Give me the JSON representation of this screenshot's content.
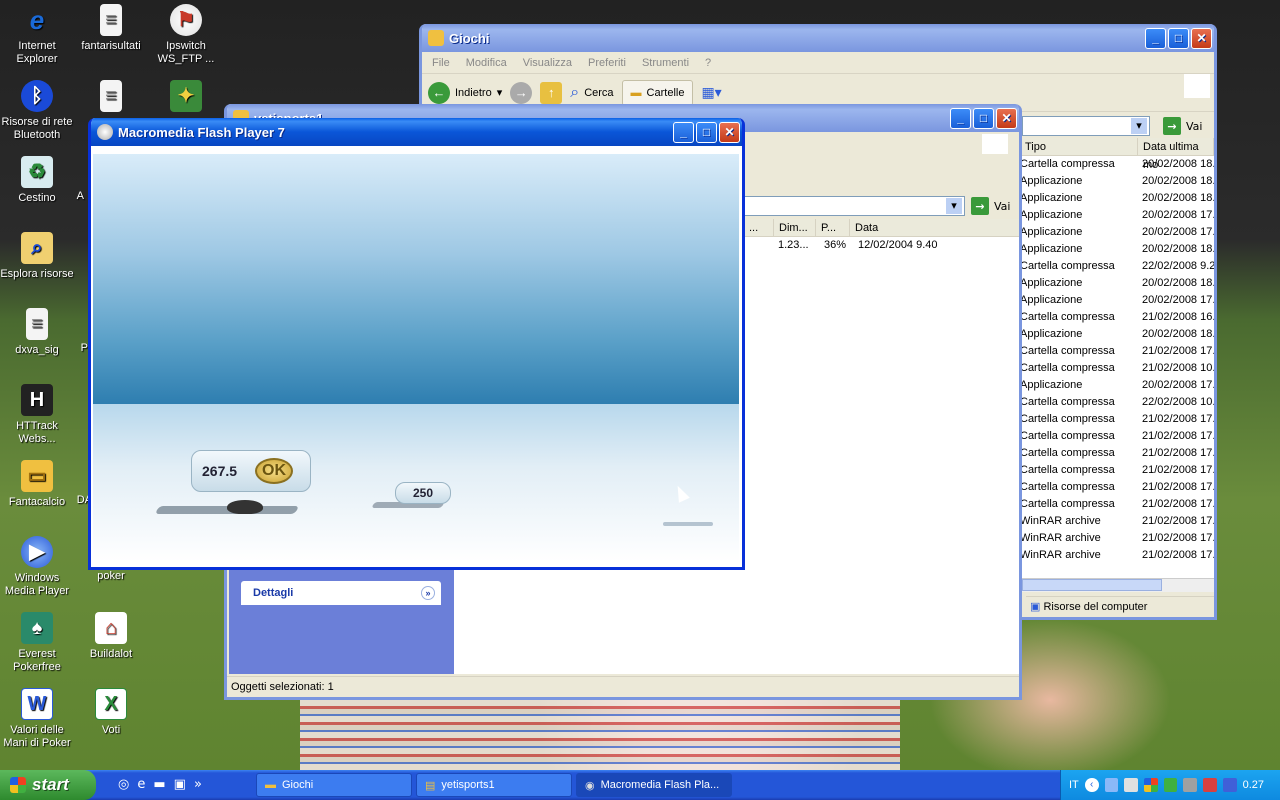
{
  "desktop": {
    "icons": [
      {
        "label": "Internet Explorer",
        "glyph": "e",
        "color": "#1a6ad8"
      },
      {
        "label": "fantarisultati",
        "glyph": "≡",
        "color": "#f4f4f4"
      },
      {
        "label": "Ipswitch WS_FTP ...",
        "glyph": "⚑",
        "color": "#c83a2a"
      },
      {
        "label": "Risorse di rete Bluetooth",
        "glyph": "ᛒ",
        "color": "#1a4ad8"
      },
      {
        "label": "Cestino",
        "glyph": "♻",
        "color": "#a8d0a8"
      },
      {
        "label": "Esplora risorse",
        "glyph": "🔍",
        "color": "#f0d070"
      },
      {
        "label": "dxva_sig",
        "glyph": "≡",
        "color": "#f4f4f4"
      },
      {
        "label": "HTTrack Webs...",
        "glyph": "H",
        "color": "#222"
      },
      {
        "label": "Fantacalcio",
        "glyph": "▭",
        "color": "#f0c040"
      },
      {
        "label": "Windows Media Player",
        "glyph": "▶",
        "color": "#4a8ae8"
      },
      {
        "label": "poker",
        "glyph": "",
        "color": "transparent"
      },
      {
        "label": "Everest Pokerfree",
        "glyph": "♠",
        "color": "#2a8a6a"
      },
      {
        "label": "Buildalot",
        "glyph": "⌂",
        "color": "#e8c040"
      },
      {
        "label": "Valori delle Mani di Poker",
        "glyph": "W",
        "color": "#2a5ad8"
      },
      {
        "label": "Voti",
        "glyph": "X",
        "color": "#2a8a3a"
      },
      {
        "label_a": "A",
        "label_p": "P",
        "label_da": "DA"
      }
    ]
  },
  "giochi_window": {
    "title": "Giochi",
    "menu": [
      "File",
      "Modifica",
      "Visualizza",
      "Preferiti",
      "Strumenti",
      "?"
    ],
    "toolbar": {
      "back": "Indietro",
      "search": "Cerca",
      "folders": "Cartelle",
      "go": "Vai"
    },
    "columns": [
      "Tipo",
      "Data ultima mo"
    ],
    "rows": [
      [
        "Cartella compressa",
        "20/02/2008 18."
      ],
      [
        "Applicazione",
        "20/02/2008 18."
      ],
      [
        "Applicazione",
        "20/02/2008 18."
      ],
      [
        "Applicazione",
        "20/02/2008 17."
      ],
      [
        "Applicazione",
        "20/02/2008 17."
      ],
      [
        "Applicazione",
        "20/02/2008 18."
      ],
      [
        "Cartella compressa",
        "22/02/2008 9.2"
      ],
      [
        "Applicazione",
        "20/02/2008 18."
      ],
      [
        "Applicazione",
        "20/02/2008 17."
      ],
      [
        "Cartella compressa",
        "21/02/2008 16."
      ],
      [
        "Applicazione",
        "20/02/2008 18."
      ],
      [
        "Cartella compressa",
        "21/02/2008 17."
      ],
      [
        "Cartella compressa",
        "21/02/2008 10."
      ],
      [
        "Applicazione",
        "20/02/2008 17."
      ],
      [
        "Cartella compressa",
        "22/02/2008 10."
      ],
      [
        "Cartella compressa",
        "21/02/2008 17."
      ],
      [
        "Cartella compressa",
        "21/02/2008 17."
      ],
      [
        "Cartella compressa",
        "21/02/2008 17."
      ],
      [
        "Cartella compressa",
        "21/02/2008 17."
      ],
      [
        "Cartella compressa",
        "21/02/2008 17."
      ],
      [
        "Cartella compressa",
        "21/02/2008 17."
      ],
      [
        "WinRAR archive",
        "21/02/2008 17."
      ],
      [
        "WinRAR archive",
        "21/02/2008 17."
      ],
      [
        "WinRAR archive",
        "21/02/2008 17."
      ]
    ],
    "status": "Risorse del computer"
  },
  "yeti_window": {
    "title": "yetisports1",
    "go": "Vai",
    "columns": [
      "...",
      "Dim...",
      "P...",
      "Data"
    ],
    "row": [
      "",
      "1.23...",
      "36%",
      "12/02/2004 9.40"
    ],
    "details": "Dettagli",
    "status": "Oggetti selezionati: 1"
  },
  "flash_window": {
    "title": "Macromedia Flash Player 7",
    "score": "267.5",
    "ok": "OK",
    "marker": "250"
  },
  "taskbar": {
    "start": "start",
    "items": [
      "Giochi",
      "yetisports1",
      "Macromedia Flash Pla..."
    ],
    "lang": "IT",
    "clock": "0.27"
  }
}
